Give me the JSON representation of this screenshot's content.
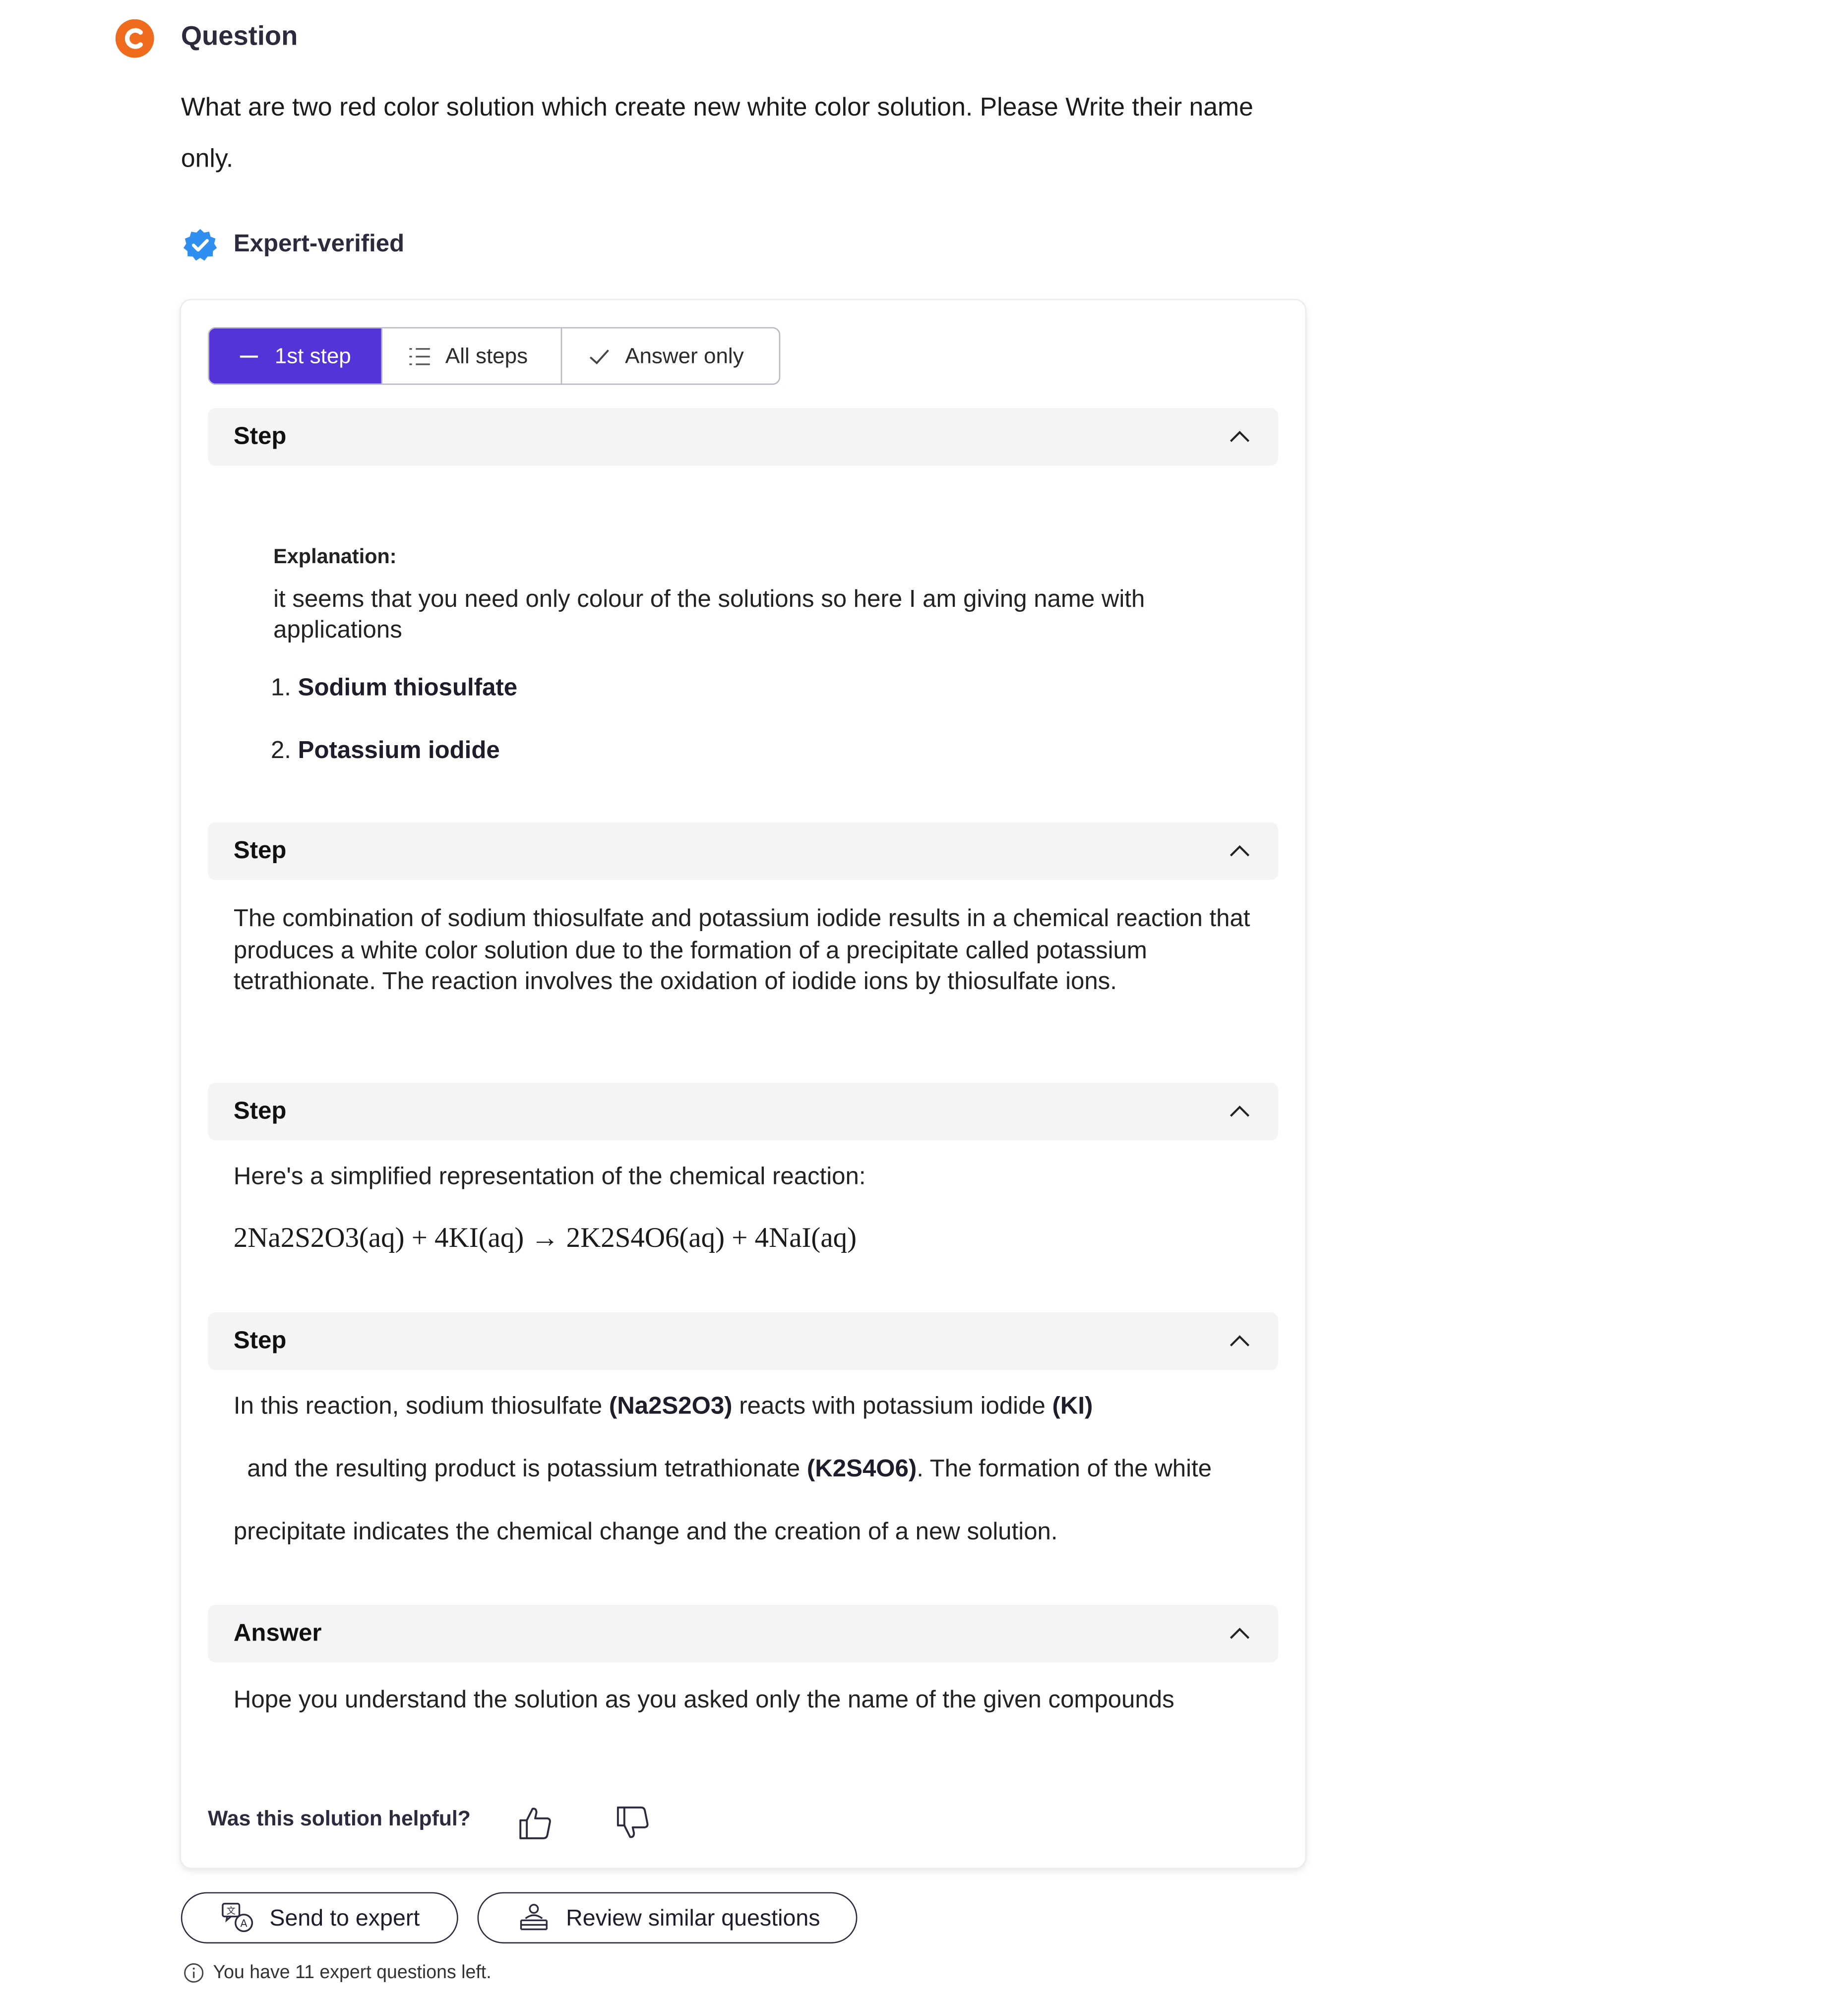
{
  "question": {
    "title": "Question",
    "text": "What are two red color solution which create new white color solution. Please Write their name only."
  },
  "verified": {
    "label": "Expert-verified"
  },
  "tabs": [
    {
      "label": "1st step",
      "icon": "dash-icon",
      "active": true
    },
    {
      "label": "All steps",
      "icon": "list-icon",
      "active": false
    },
    {
      "label": "Answer only",
      "icon": "check-icon",
      "active": false
    }
  ],
  "sections": [
    {
      "label": "Step",
      "explanation_title": "Explanation:",
      "explanation_text": "it seems that you need only colour of the solutions so here I am giving name with applications",
      "list": [
        {
          "num": "1.",
          "text": "Sodium thiosulfate"
        },
        {
          "num": "2.",
          "text": "Potassium iodide"
        }
      ]
    },
    {
      "label": "Step",
      "text": "The combination of sodium thiosulfate and potassium iodide results in a chemical reaction that produces a white color solution due to the formation of a precipitate called potassium tetrathionate. The reaction involves the oxidation of iodide ions by thiosulfate ions."
    },
    {
      "label": "Step",
      "text": "Here's a simplified representation of the chemical reaction:",
      "equation": "2Na2S2O3(aq) + 4KI(aq) → 2K2S4O6(aq) + 4NaI(aq)"
    },
    {
      "label": "Step",
      "parts": [
        "In this reaction, sodium thiosulfate ",
        "(Na2S2O3)",
        " reacts with potassium iodide ",
        "(KI)",
        "  and the resulting product is potassium tetrathionate ",
        "(K2S4O6)",
        ". The formation of the white precipitate indicates the chemical change and the creation of a new solution."
      ]
    },
    {
      "label": "Answer",
      "text": "Hope you understand the solution as you asked only the name of the given compounds"
    }
  ],
  "feedback": {
    "question": "Was this solution helpful?"
  },
  "buttons": {
    "send_expert": "Send to expert",
    "review_similar": "Review similar questions"
  },
  "info": {
    "text": "You have 11 expert questions left."
  },
  "colors": {
    "brand": "#f06b1d",
    "active_tab": "#5433d9",
    "verified": "#2f8ff0",
    "section_bg": "#f4f4f6"
  }
}
